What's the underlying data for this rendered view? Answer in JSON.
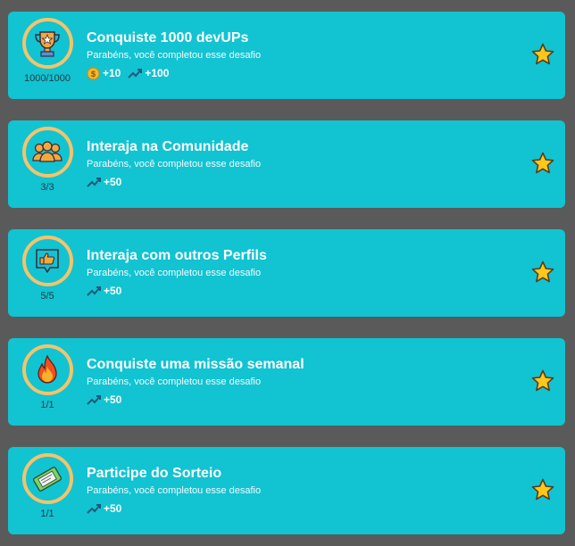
{
  "challenges": [
    {
      "title": "Conquiste 1000 devUPs",
      "subtitle": "Parabéns, você completou esse desafio",
      "progress": "1000/1000",
      "icon": "trophy-icon",
      "coins": "+10",
      "xp": "+100"
    },
    {
      "title": "Interaja na Comunidade",
      "subtitle": "Parabéns, você completou esse desafio",
      "progress": "3/3",
      "icon": "community-icon",
      "xp": "+50"
    },
    {
      "title": "Interaja com outros Perfils",
      "subtitle": "Parabéns, você completou esse desafio",
      "progress": "5/5",
      "icon": "thumbs-up-icon",
      "xp": "+50"
    },
    {
      "title": "Conquiste uma missão semanal",
      "subtitle": "Parabéns, você completou esse desafio",
      "progress": "1/1",
      "icon": "fire-icon",
      "xp": "+50"
    },
    {
      "title": "Participe do Sorteio",
      "subtitle": "Parabéns, você completou esse desafio",
      "progress": "1/1",
      "icon": "ticket-icon",
      "xp": "+50"
    }
  ],
  "colors": {
    "card": "#12c3d2",
    "badge_ring": "#f4c46a",
    "star": "#ffc61b",
    "background": "#5a5a5a"
  }
}
